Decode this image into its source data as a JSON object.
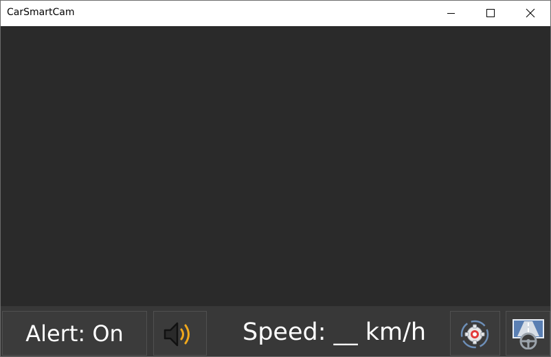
{
  "window": {
    "title": "CarSmartCam"
  },
  "controls": {
    "alert_label": "Alert: On",
    "speed_label": "Speed: __ km/h"
  },
  "icons": {
    "sound": "speaker-volume-icon",
    "settings": "settings-gear-icon",
    "drive": "steering-wheel-road-icon"
  },
  "colors": {
    "background": "#2a2a2a",
    "bottom_bar": "#383838",
    "button": "#3b3b3b",
    "accent_orange": "#f0a81c",
    "accent_red": "#e23b3b"
  }
}
